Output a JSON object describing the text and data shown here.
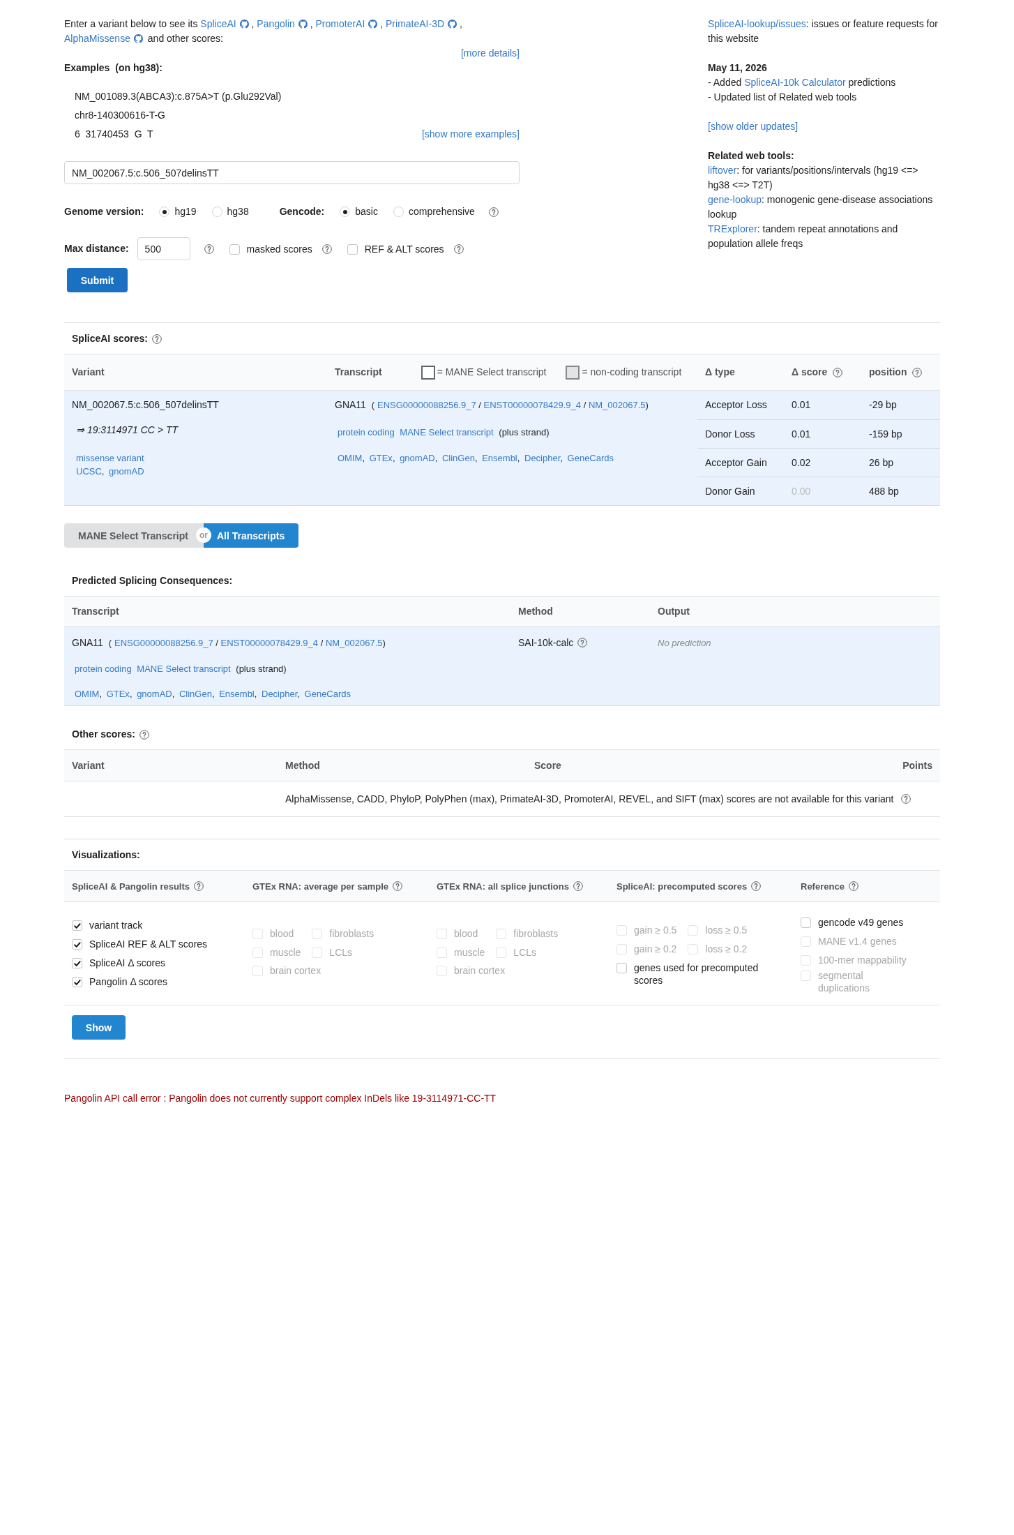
{
  "intro": {
    "lead": "Enter a variant below to see its",
    "tools": [
      "SpliceAI",
      "Pangolin",
      "PromoterAI",
      "PrimateAI-3D",
      "AlphaMissense"
    ],
    "separator": ",",
    "tail": "and other scores:",
    "more": "[more details]"
  },
  "examples": {
    "title": "Examples",
    "note": "(on hg38):",
    "items": [
      "NM_001089.3(ABCA3):c.875A>T (p.Glu292Val)",
      "chr8-140300616-T-G",
      "6  31740453  G  T"
    ],
    "more": "[show more examples]"
  },
  "variant_input": {
    "value": "NM_002067.5:c.506_507delinsTT"
  },
  "genome": {
    "label": "Genome version:",
    "options": [
      {
        "label": "hg19",
        "selected": true
      },
      {
        "label": "hg38",
        "selected": false
      }
    ]
  },
  "gencode": {
    "label": "Gencode:",
    "options": [
      {
        "label": "basic",
        "selected": true
      },
      {
        "label": "comprehensive",
        "selected": false
      }
    ]
  },
  "max_distance": {
    "label": "Max distance:",
    "value": "500"
  },
  "score_options": [
    {
      "label": "masked scores",
      "checked": false
    },
    {
      "label": "REF & ALT scores",
      "checked": false
    }
  ],
  "submit": "Submit",
  "sidebar": {
    "issues": {
      "link": "SpliceAI-lookup/issues",
      "text": ": issues or feature requests for this website"
    },
    "news": {
      "date": "May 11, 2026",
      "items": [
        {
          "text": "- Added",
          "link": "SpliceAI-10k Calculator",
          "rest": "predictions"
        },
        {
          "text": "- Updated list of Related web tools"
        }
      ]
    },
    "older": "[show older updates]",
    "related": {
      "title": "Related web tools:",
      "tools": [
        {
          "name": "liftover",
          "description": ": for variants/positions/intervals (hg19 <=> hg38 <=> T2T)"
        },
        {
          "name": "gene-lookup",
          "description": ": monogenic gene-disease associations lookup"
        },
        {
          "name": "TRExplorer",
          "description": ": tandem repeat annotations and population allele freqs"
        }
      ]
    }
  },
  "spliceai": {
    "title": "SpliceAI scores:",
    "columns": [
      {
        "label": "Variant",
        "help": false
      },
      {
        "label": "Transcript",
        "help": false,
        "legend": [
          {
            "label": "= MANE Select transcript",
            "kind": "mane"
          },
          {
            "label": "= non-coding transcript",
            "kind": "noncoding"
          }
        ]
      },
      {
        "label": "Δ type",
        "help": false
      },
      {
        "label": "Δ score",
        "help": true
      },
      {
        "label": "position",
        "help": true
      }
    ],
    "variant": {
      "name": "NM_002067.5:c.506_507delinsTT",
      "coords": "⇒ 19:3114971 CC > TT",
      "consequence": "missense variant",
      "links": [
        "UCSC",
        "gnomAD"
      ],
      "link_separator": ","
    },
    "transcript": {
      "gene": "GNA11",
      "open": "(",
      "ids": [
        "ENSG00000088256.9_7",
        "ENST00000078429.9_4",
        "NM_002067.5"
      ],
      "id_separator": "/",
      "close": ")",
      "tags": [
        "protein coding",
        "MANE Select transcript"
      ],
      "strand": "(plus strand)",
      "links": [
        "OMIM",
        "GTEx",
        "gnomAD",
        "ClinGen",
        "Ensembl",
        "Decipher",
        "GeneCards"
      ],
      "link_separator": ","
    },
    "deltas": [
      {
        "type": "Acceptor Loss",
        "score": "0.01",
        "position": "-29 bp",
        "dimmed": false
      },
      {
        "type": "Donor Loss",
        "score": "0.01",
        "position": "-159 bp",
        "dimmed": false
      },
      {
        "type": "Acceptor Gain",
        "score": "0.02",
        "position": "26 bp",
        "dimmed": false
      },
      {
        "type": "Donor Gain",
        "score": "0.00",
        "position": "488 bp",
        "dimmed": true
      }
    ]
  },
  "toggle": {
    "options": [
      {
        "label": "MANE Select Transcript",
        "selected": false
      },
      {
        "label": "All Transcripts",
        "selected": true
      }
    ],
    "divider": "or"
  },
  "predicted": {
    "title": "Predicted Splicing Consequences:",
    "columns": [
      "Transcript",
      "Method",
      "Output"
    ],
    "rows": [
      {
        "transcript": {
          "gene": "GNA11",
          "open": "(",
          "ids": [
            "ENSG00000088256.9_7",
            "ENST00000078429.9_4",
            "NM_002067.5"
          ],
          "id_separator": "/",
          "close": ")",
          "tags": [
            "protein coding",
            "MANE Select transcript"
          ],
          "strand": "(plus strand)",
          "links": [
            "OMIM",
            "GTEx",
            "gnomAD",
            "ClinGen",
            "Ensembl",
            "Decipher",
            "GeneCards"
          ],
          "link_separator": ","
        },
        "method": "SAI-10k-calc",
        "output": "No prediction"
      }
    ]
  },
  "other_scores": {
    "title": "Other scores:",
    "columns": [
      "Variant",
      "Method",
      "Score",
      "Points"
    ],
    "message": "AlphaMissense, CADD, PhyloP, PolyPhen (max), PrimateAI-3D, PromoterAI, REVEL, and SIFT (max) scores are not available for this variant"
  },
  "visualizations": {
    "title": "Visualizations:",
    "groups": [
      {
        "title": "SpliceAI & Pangolin results",
        "kind": "list",
        "items": [
          {
            "label": "variant track",
            "checked": true,
            "disabled": false
          },
          {
            "label": "SpliceAI REF & ALT scores",
            "checked": true,
            "disabled": false
          },
          {
            "label": "SpliceAI Δ scores",
            "checked": true,
            "disabled": false
          },
          {
            "label": "Pangolin Δ  scores",
            "checked": true,
            "disabled": false
          }
        ]
      },
      {
        "title": "GTEx RNA: average per sample",
        "kind": "grid",
        "items": [
          {
            "label": "blood",
            "checked": false,
            "disabled": true
          },
          {
            "label": "fibroblasts",
            "checked": false,
            "disabled": true
          },
          {
            "label": "muscle",
            "checked": false,
            "disabled": true
          },
          {
            "label": "LCLs",
            "checked": false,
            "disabled": true
          },
          {
            "label": "brain cortex",
            "checked": false,
            "disabled": true
          }
        ]
      },
      {
        "title": "GTEx RNA: all splice junctions",
        "kind": "grid",
        "items": [
          {
            "label": "blood",
            "checked": false,
            "disabled": true
          },
          {
            "label": "fibroblasts",
            "checked": false,
            "disabled": true
          },
          {
            "label": "muscle",
            "checked": false,
            "disabled": true
          },
          {
            "label": "LCLs",
            "checked": false,
            "disabled": true
          },
          {
            "label": "brain cortex",
            "checked": false,
            "disabled": true
          }
        ]
      },
      {
        "title": "SpliceAI: precomputed scores",
        "kind": "grid",
        "items": [
          {
            "label": "gain ≥ 0.5",
            "checked": false,
            "disabled": true
          },
          {
            "label": "loss ≥ 0.5",
            "checked": false,
            "disabled": true
          },
          {
            "label": "gain ≥ 0.2",
            "checked": false,
            "disabled": true
          },
          {
            "label": "loss ≥ 0.2",
            "checked": false,
            "disabled": true
          },
          {
            "label": "genes used for precomputed scores",
            "checked": false,
            "disabled": false
          }
        ]
      },
      {
        "title": "Reference",
        "kind": "list",
        "items": [
          {
            "label": "gencode v49 genes",
            "checked": false,
            "disabled": false
          },
          {
            "label": "MANE v1.4 genes",
            "checked": false,
            "disabled": true
          },
          {
            "label": "100-mer mappability",
            "checked": false,
            "disabled": true
          },
          {
            "label": "segmental duplications",
            "checked": false,
            "disabled": true
          }
        ]
      }
    ],
    "show": "Show"
  },
  "error": "Pangolin API call error : Pangolin does not currently support complex InDels like 19-3114971-CC-TT"
}
